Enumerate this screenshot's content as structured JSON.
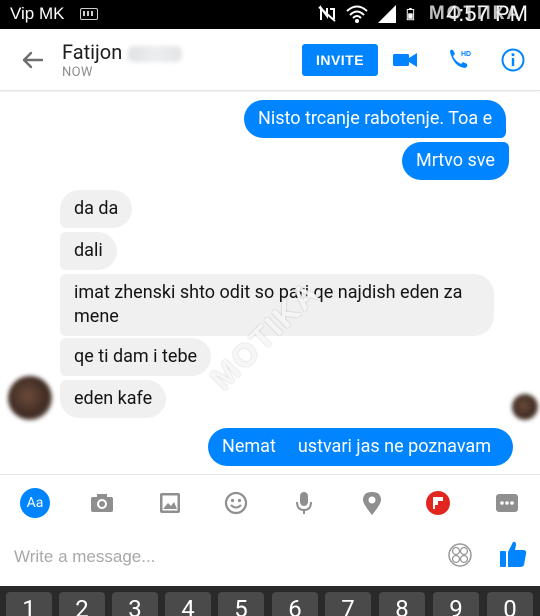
{
  "status_bar": {
    "carrier": "Vip MK",
    "time": "4:57 PM"
  },
  "header": {
    "contact_name": "Fatijon",
    "contact_status": "NOW",
    "invite_label": "INVITE",
    "icons": [
      "back-arrow-icon",
      "video-call-icon",
      "hd-phone-icon",
      "info-icon"
    ]
  },
  "messages": [
    {
      "direction": "out",
      "text": "Nisto trcanje rabotenje. Toa e"
    },
    {
      "direction": "out",
      "text": "Mrtvo sve"
    },
    {
      "direction": "in",
      "text": "da da"
    },
    {
      "direction": "in",
      "text": "dali"
    },
    {
      "direction": "in",
      "text_line1": "imat zhenski shto odit so pari qe najdish eden za",
      "text_line2": "mene"
    },
    {
      "direction": "in",
      "text": "qe ti dam i tebe"
    },
    {
      "direction": "in",
      "text": "eden kafe"
    },
    {
      "direction": "out",
      "text_part1": "Nemat",
      "text_part2": "ustvari jas ne poznavam"
    }
  ],
  "toolbar": {
    "aa_label": "Aa",
    "icons": [
      "aa-icon",
      "camera-icon",
      "gallery-icon",
      "emoji-icon",
      "microphone-icon",
      "location-icon",
      "flipboard-icon",
      "more-icon"
    ],
    "accent": "#0084ff",
    "flip_color": "#e0261e"
  },
  "composer": {
    "placeholder": "Write a message..."
  },
  "keyboard": {
    "keys": [
      "1",
      "2",
      "3",
      "4",
      "5",
      "6",
      "7",
      "8",
      "9",
      "0"
    ]
  },
  "watermark": {
    "text": "MOTIKA",
    "corner_text": "МОТИКА"
  },
  "colors": {
    "outgoing_bubble": "#0084ff",
    "incoming_bubble": "#f0f0f0"
  }
}
